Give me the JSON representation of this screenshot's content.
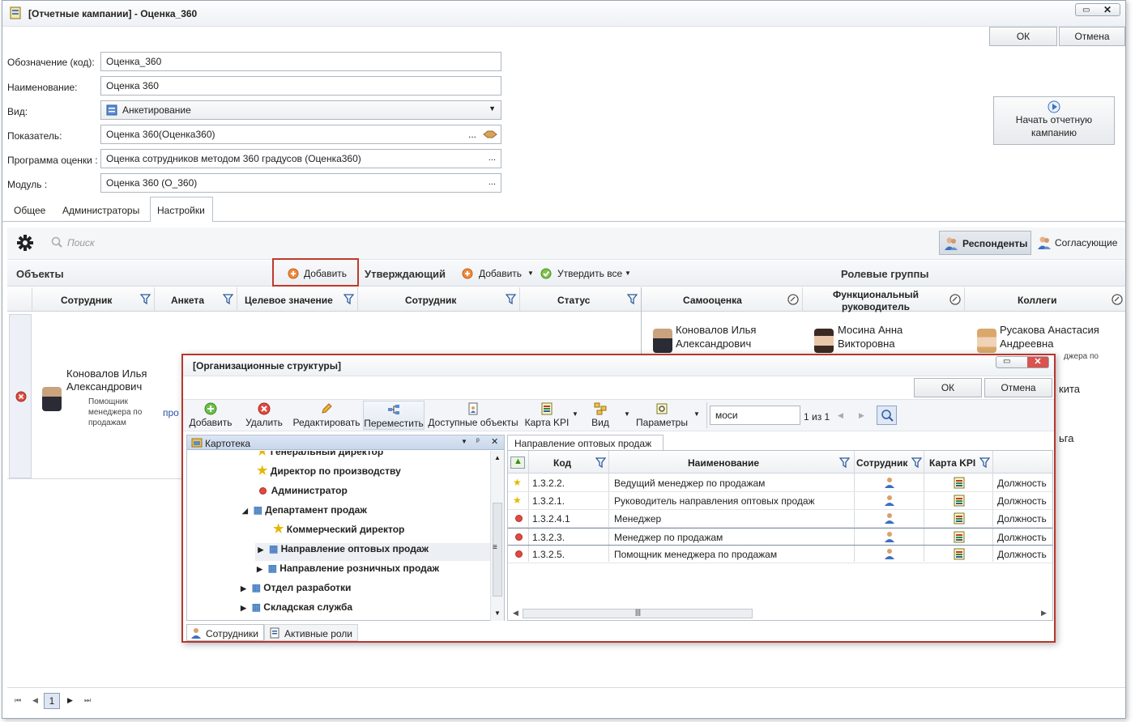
{
  "window": {
    "title": "[Отчетные кампании] - Оценка_360",
    "ok_label": "ОК",
    "cancel_label": "Отмена",
    "start_button_label": "Начать отчетную кампанию"
  },
  "form": {
    "code_label": "Обозначение (код):",
    "code_value": "Оценка_360",
    "name_label": "Наименование:",
    "name_value": "Оценка 360",
    "type_label": "Вид:",
    "type_value": "Анкетирование",
    "indicator_label": "Показатель:",
    "indicator_value": "Оценка 360(Оценка360)",
    "program_label": "Программа оценки :",
    "program_value": "Оценка сотрудников методом 360 градусов (Оценка360)",
    "module_label": "Модуль :",
    "module_value": "Оценка 360 (О_360)",
    "ellipsis": "..."
  },
  "tabs": [
    "Общее",
    "Администраторы",
    "Настройки"
  ],
  "settings": {
    "search_placeholder": "Поиск",
    "respondents_label": "Респонденты",
    "approvers_label": "Согласующие",
    "objects_title": "Объекты",
    "add_label": "Добавить",
    "approver_title": "Утверждающий",
    "approve_all_label": "Утвердить все",
    "role_groups_title": "Ролевые группы",
    "objects_columns": [
      "Сотрудник",
      "Анкета",
      "Целевое значение",
      "Сотрудник",
      "Статус"
    ],
    "role_columns": [
      "Самооценка",
      "Функциональный руководитель",
      "Коллеги"
    ],
    "row": {
      "name": "Коновалов Илья Александрович",
      "position": "Помощник менеджера по продажам",
      "partial_text": "про"
    },
    "role_people": [
      {
        "name": "Коновалов Илья Александрович"
      },
      {
        "name": "Мосина Анна Викторовна"
      },
      {
        "name": "Русакова Анастасия Андреевна",
        "extra": "джера по"
      }
    ],
    "partial_right": [
      "кита",
      "ьга"
    ],
    "pager_page": "1"
  },
  "dialog": {
    "title": "[Организационные структуры]",
    "ok_label": "ОК",
    "cancel_label": "Отмена",
    "toolbar": [
      "Добавить",
      "Удалить",
      "Редактировать",
      "Переместить",
      "Доступные объекты",
      "Карта KPI",
      "Вид",
      "Параметры"
    ],
    "search_value": "моси",
    "search_count": "1 из 1",
    "tree_panel_title": "Картотека",
    "tree": [
      "Генеральный директор",
      "Директор по производству",
      "Администратор",
      "Департамент продаж",
      "Коммерческий директор",
      "Направление оптовых продаж",
      "Направление розничных продаж",
      "Отдел разработки",
      "Складская служба"
    ],
    "bottom_tabs": [
      "Сотрудники",
      "Активные роли"
    ],
    "grid_tab": "Направление оптовых продаж",
    "grid_columns": [
      "Код",
      "Наименование",
      "Сотрудник",
      "Карта KPI"
    ],
    "rows": [
      {
        "code": "1.3.2.2.",
        "name": "Ведущий менеджер по продажам",
        "type": "Должность"
      },
      {
        "code": "1.3.2.1.",
        "name": "Руководитель направления оптовых продаж",
        "type": "Должность"
      },
      {
        "code": "1.3.2.4.1",
        "name": "Менеджер",
        "type": "Должность"
      },
      {
        "code": "1.3.2.3.",
        "name": "Менеджер по продажам",
        "type": "Должность"
      },
      {
        "code": "1.3.2.5.",
        "name": "Помощник менеджера по продажам",
        "type": "Должность"
      }
    ]
  }
}
